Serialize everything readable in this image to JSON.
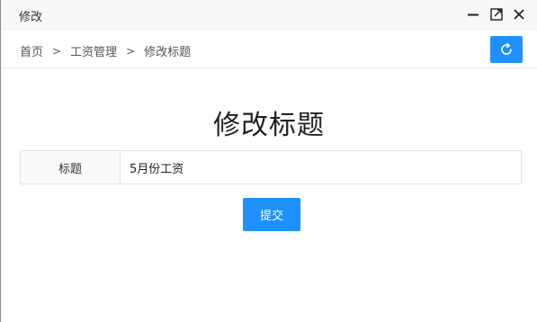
{
  "window": {
    "title": "修改"
  },
  "breadcrumb": {
    "items": [
      "首页",
      "工资管理",
      "修改标题"
    ],
    "separator": ">"
  },
  "page": {
    "heading": "修改标题"
  },
  "form": {
    "title_label": "标题",
    "title_value": "5月份工资",
    "submit_label": "提交"
  },
  "colors": {
    "accent": "#1e90ff"
  },
  "icons": {
    "minimize": "minimize-icon",
    "maximize": "maximize-icon",
    "close": "close-icon",
    "refresh": "refresh-icon"
  }
}
